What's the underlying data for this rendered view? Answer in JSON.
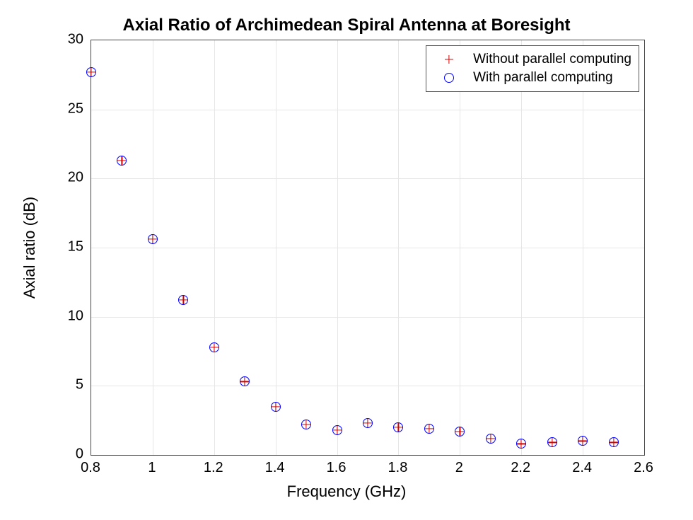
{
  "chart_data": {
    "type": "scatter",
    "title": "Axial Ratio of Archimedean Spiral Antenna at Boresight",
    "xlabel": "Frequency (GHz)",
    "ylabel": "Axial ratio (dB)",
    "xlim": [
      0.8,
      2.6
    ],
    "ylim": [
      0,
      30
    ],
    "xticks": [
      0.8,
      1,
      1.2,
      1.4,
      1.6,
      1.8,
      2,
      2.2,
      2.4,
      2.6
    ],
    "yticks": [
      0,
      5,
      10,
      15,
      20,
      25,
      30
    ],
    "grid": true,
    "legend_position": "northeast",
    "x": [
      0.8,
      0.9,
      1.0,
      1.1,
      1.2,
      1.3,
      1.4,
      1.5,
      1.6,
      1.7,
      1.8,
      1.9,
      2.0,
      2.1,
      2.2,
      2.3,
      2.4,
      2.5
    ],
    "series": [
      {
        "name": "Without parallel computing",
        "marker": "plus",
        "color": "#d70000",
        "values": [
          27.7,
          21.3,
          15.6,
          11.2,
          7.8,
          5.3,
          3.5,
          2.2,
          1.8,
          2.3,
          2.0,
          1.9,
          1.7,
          1.2,
          0.8,
          0.9,
          1.0,
          0.9
        ]
      },
      {
        "name": "With parallel computing",
        "marker": "circle",
        "color": "#0000ff",
        "values": [
          27.7,
          21.3,
          15.6,
          11.2,
          7.8,
          5.3,
          3.5,
          2.2,
          1.8,
          2.3,
          2.0,
          1.9,
          1.7,
          1.2,
          0.8,
          0.9,
          1.0,
          0.9
        ]
      }
    ]
  }
}
